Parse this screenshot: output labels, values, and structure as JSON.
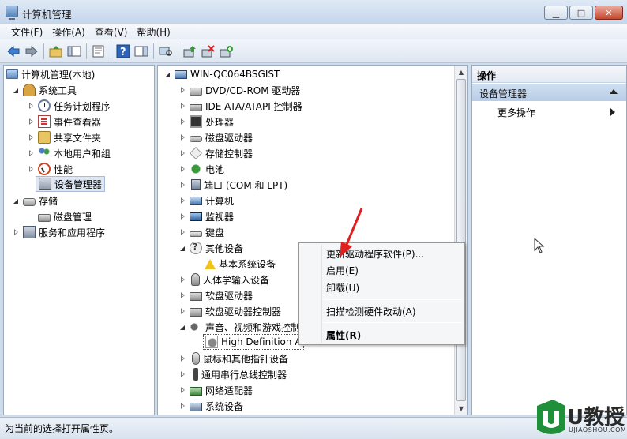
{
  "window": {
    "title": "计算机管理"
  },
  "menu": [
    "文件(F)",
    "操作(A)",
    "查看(V)",
    "帮助(H)"
  ],
  "left_tree": [
    {
      "label": "计算机管理(本地)",
      "level": 0,
      "expander": "none",
      "icon": "computer-icon"
    },
    {
      "label": "系统工具",
      "level": 1,
      "expander": "open",
      "icon": "tools-icon"
    },
    {
      "label": "任务计划程序",
      "level": 2,
      "expander": "closed",
      "icon": "clock-icon"
    },
    {
      "label": "事件查看器",
      "level": 2,
      "expander": "closed",
      "icon": "event-icon"
    },
    {
      "label": "共享文件夹",
      "level": 2,
      "expander": "closed",
      "icon": "shared-folder-icon"
    },
    {
      "label": "本地用户和组",
      "level": 2,
      "expander": "closed",
      "icon": "users-icon"
    },
    {
      "label": "性能",
      "level": 2,
      "expander": "closed",
      "icon": "performance-icon"
    },
    {
      "label": "设备管理器",
      "level": 2,
      "expander": "none",
      "icon": "device-manager-icon",
      "selected": true
    },
    {
      "label": "存储",
      "level": 1,
      "expander": "open",
      "icon": "storage-icon"
    },
    {
      "label": "磁盘管理",
      "level": 2,
      "expander": "none",
      "icon": "disk-icon"
    },
    {
      "label": "服务和应用程序",
      "level": 1,
      "expander": "closed",
      "icon": "services-icon"
    }
  ],
  "device_tree": [
    {
      "label": "WIN-QC064BSGIST",
      "level": 0,
      "expander": "open",
      "icon": "pc-icon"
    },
    {
      "label": "DVD/CD-ROM 驱动器",
      "level": 1,
      "expander": "closed",
      "icon": "cdrom-icon"
    },
    {
      "label": "IDE ATA/ATAPI 控制器",
      "level": 1,
      "expander": "closed",
      "icon": "ide-icon"
    },
    {
      "label": "处理器",
      "level": 1,
      "expander": "closed",
      "icon": "cpu-icon"
    },
    {
      "label": "磁盘驱动器",
      "level": 1,
      "expander": "closed",
      "icon": "disk-drive-icon"
    },
    {
      "label": "存储控制器",
      "level": 1,
      "expander": "closed",
      "icon": "storage-controller-icon"
    },
    {
      "label": "电池",
      "level": 1,
      "expander": "closed",
      "icon": "battery-icon"
    },
    {
      "label": "端口 (COM 和 LPT)",
      "level": 1,
      "expander": "closed",
      "icon": "port-icon"
    },
    {
      "label": "计算机",
      "level": 1,
      "expander": "closed",
      "icon": "computer-icon"
    },
    {
      "label": "监视器",
      "level": 1,
      "expander": "closed",
      "icon": "monitor-icon"
    },
    {
      "label": "键盘",
      "level": 1,
      "expander": "closed",
      "icon": "keyboard-icon"
    },
    {
      "label": "其他设备",
      "level": 1,
      "expander": "open",
      "icon": "other-devices-icon"
    },
    {
      "label": "基本系统设备",
      "level": 2,
      "expander": "none",
      "icon": "warning-icon"
    },
    {
      "label": "人体学输入设备",
      "level": 1,
      "expander": "closed",
      "icon": "hid-icon"
    },
    {
      "label": "软盘驱动器",
      "level": 1,
      "expander": "closed",
      "icon": "floppy-icon"
    },
    {
      "label": "软盘驱动器控制器",
      "level": 1,
      "expander": "closed",
      "icon": "floppy-controller-icon"
    },
    {
      "label": "声音、视频和游戏控制",
      "level": 1,
      "expander": "open",
      "icon": "sound-icon"
    },
    {
      "label": "High Definition A",
      "level": 2,
      "expander": "none",
      "icon": "audio-device-icon",
      "selected": true
    },
    {
      "label": "鼠标和其他指针设备",
      "level": 1,
      "expander": "closed",
      "icon": "mouse-icon"
    },
    {
      "label": "通用串行总线控制器",
      "level": 1,
      "expander": "closed",
      "icon": "usb-icon"
    },
    {
      "label": "网络适配器",
      "level": 1,
      "expander": "closed",
      "icon": "network-icon"
    },
    {
      "label": "系统设备",
      "level": 1,
      "expander": "closed",
      "icon": "system-device-icon"
    }
  ],
  "actions": {
    "header": "操作",
    "section": "设备管理器",
    "more": "更多操作"
  },
  "context_menu": {
    "update_driver": "更新驱动程序软件(P)...",
    "enable": "启用(E)",
    "uninstall": "卸载(U)",
    "scan": "扫描检测硬件改动(A)",
    "properties": "属性(R)"
  },
  "status": "为当前的选择打开属性页。",
  "watermark": {
    "brand": "U教授",
    "site": "UJIAOSHOU.COM"
  }
}
